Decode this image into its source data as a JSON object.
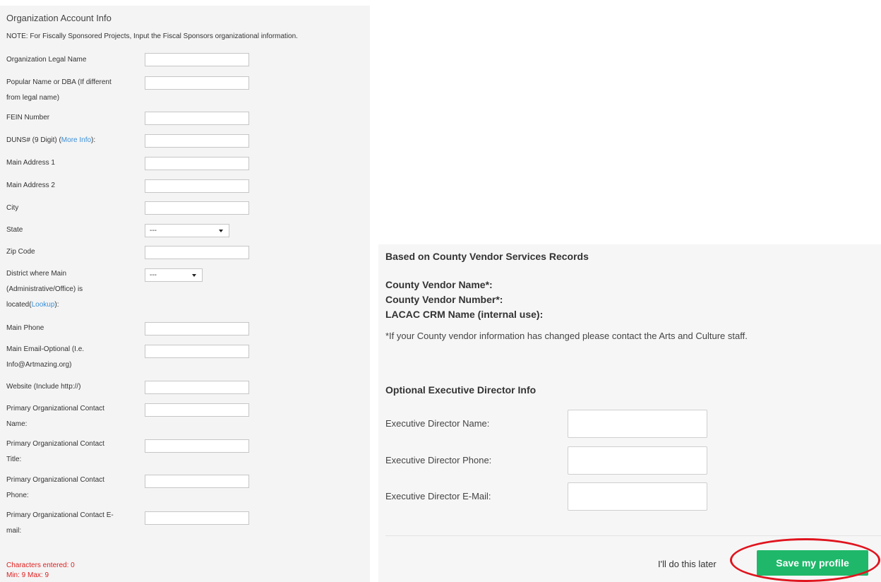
{
  "left": {
    "title": "Organization Account Info",
    "note": "NOTE: For Fiscally Sponsored Projects, Input the Fiscal Sponsors organizational information.",
    "fields": {
      "legal_name": "Organization Legal Name",
      "popular_name_1": "Popular Name or DBA (If different",
      "popular_name_2": "from legal name)",
      "fein": "FEIN Number",
      "duns_prefix": "DUNS# (9 Digit) (",
      "duns_link": "More Info",
      "duns_suffix": "):",
      "address1": "Main Address 1",
      "address2": "Main Address 2",
      "city": "City",
      "state": "State",
      "state_value": "---",
      "zip": "Zip Code",
      "district_1": "District where Main",
      "district_2": "(Administrative/Office) is",
      "district_3": "located(",
      "district_link": "Lookup",
      "district_4": "):",
      "district_value": "---",
      "phone": "Main Phone",
      "email_1": "Main Email-Optional (I.e.",
      "email_2": "Info@Artmazing.org)",
      "website": "Website (Include http://)",
      "contact_name_1": "Primary Organizational Contact",
      "contact_name_2": "Name:",
      "contact_title_1": "Primary Organizational Contact",
      "contact_title_2": "Title:",
      "contact_phone_1": "Primary Organizational Contact",
      "contact_phone_2": "Phone:",
      "contact_email_1": "Primary Organizational Contact E-",
      "contact_email_2": "mail:"
    },
    "chars_entered": "Characters entered: 0",
    "min_max": "Min: 9 Max: 9"
  },
  "right": {
    "records_heading": "Based on County Vendor Services Records",
    "vendor_name": "County Vendor Name*:",
    "vendor_number": "County Vendor Number*:",
    "crm_name": "LACAC CRM Name (internal use):",
    "vendor_note": "*If your County vendor information has changed please contact the Arts and Culture staff.",
    "exec_heading": "Optional Executive Director Info",
    "exec_name": "Executive Director Name:",
    "exec_phone": "Executive Director Phone:",
    "exec_email": "Executive Director E-Mail:",
    "later": "I'll do this later",
    "save": "Save my profile"
  },
  "colors": {
    "save_button": "#1fb86a",
    "highlight_ring": "#e0141e",
    "error_text": "#e02020",
    "link": "#3a8fd6"
  }
}
